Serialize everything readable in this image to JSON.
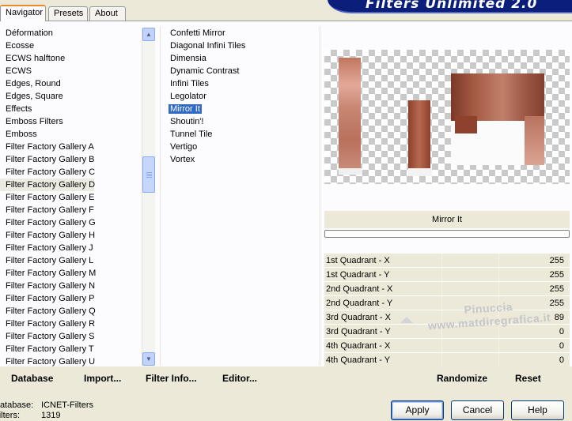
{
  "tabs": [
    "Navigator",
    "Presets",
    "About"
  ],
  "app_title": "Filters Unlimited 2.0",
  "categories": [
    "Déformation",
    "Ecosse",
    "ECWS halftone",
    "ECWS",
    "Edges, Round",
    "Edges, Square",
    "Effects",
    "Emboss Filters",
    "Emboss",
    "Filter Factory Gallery A",
    "Filter Factory Gallery B",
    "Filter Factory Gallery C",
    "Filter Factory Gallery D",
    "Filter Factory Gallery E",
    "Filter Factory Gallery F",
    "Filter Factory Gallery G",
    "Filter Factory Gallery H",
    "Filter Factory Gallery J",
    "Filter Factory Gallery L",
    "Filter Factory Gallery M",
    "Filter Factory Gallery N",
    "Filter Factory Gallery P",
    "Filter Factory Gallery Q",
    "Filter Factory Gallery R",
    "Filter Factory Gallery S",
    "Filter Factory Gallery T",
    "Filter Factory Gallery U"
  ],
  "selected_category": "Filter Factory Gallery D",
  "filters": [
    "Confetti Mirror",
    "Diagonal Infini Tiles",
    "Dimensia",
    "Dynamic Contrast",
    "Infini Tiles",
    "Legolator",
    "Mirror It",
    "Shoutin'!",
    "Tunnel Tile",
    "Vertigo",
    "Vortex"
  ],
  "selected_filter": "Mirror It",
  "preview": {
    "filter_name": "Mirror It",
    "progress": 0
  },
  "params": [
    {
      "label": "1st Quadrant - X",
      "value": "255"
    },
    {
      "label": "1st Quadrant - Y",
      "value": "255"
    },
    {
      "label": "2nd Quadrant - X",
      "value": "255"
    },
    {
      "label": "2nd Quadrant - Y",
      "value": "255"
    },
    {
      "label": "3rd Quadrant - X",
      "value": "89"
    },
    {
      "label": "3rd Quadrant - Y",
      "value": "0"
    },
    {
      "label": "4th Quadrant - X",
      "value": "0"
    },
    {
      "label": "4th Quadrant - Y",
      "value": "0"
    }
  ],
  "watermark": {
    "line1": "Pinuccia",
    "line2": "www.matdiregrafica.it"
  },
  "toolbar": {
    "database": "Database",
    "import": "Import...",
    "filter_info": "Filter Info...",
    "editor": "Editor...",
    "randomize": "Randomize",
    "reset": "Reset"
  },
  "status": {
    "database_label": "Database:",
    "database_value": "ICNET-Filters",
    "filters_label": "Filters:",
    "filters_value": "1319"
  },
  "buttons": {
    "apply": "Apply",
    "cancel": "Cancel",
    "help": "Help"
  },
  "icons": {
    "scroll_up": "triangle-up-icon",
    "scroll_down": "triangle-down-icon"
  },
  "colors": {
    "banner": "#0a1e7a",
    "selection": "#316ac5",
    "tab_accent": "#e68b2c"
  }
}
